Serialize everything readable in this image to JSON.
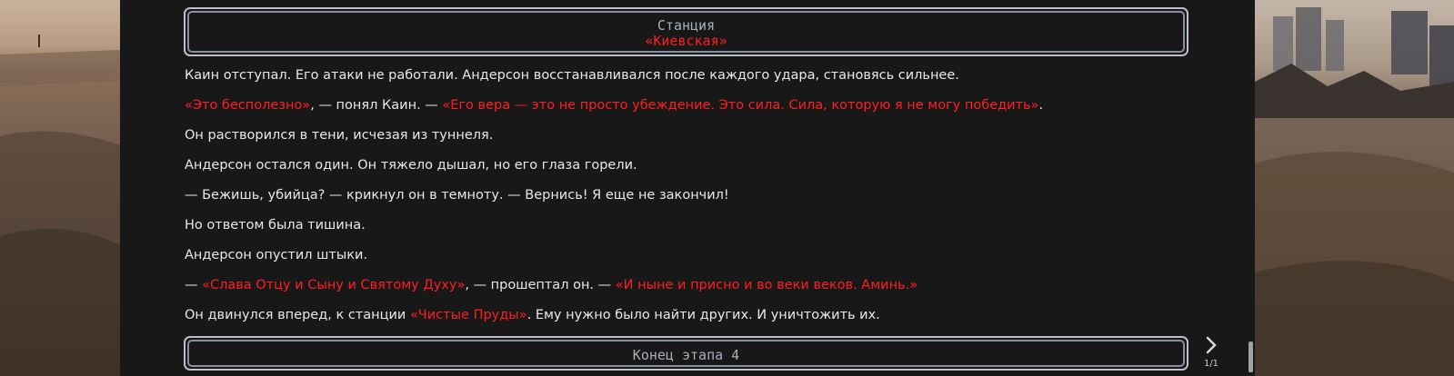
{
  "header": {
    "station_label": "Станция",
    "station_name": "«Киевская»"
  },
  "story": {
    "lines": [
      [
        {
          "text": "Каин отступал. Его атаки не работали. Андерсон восстанавливался после каждого удара, становясь сильнее.",
          "red": false
        }
      ],
      [
        {
          "text": "«Это бесполезно»",
          "red": true
        },
        {
          "text": ", — понял Каин. — ",
          "red": false
        },
        {
          "text": "«Его вера — это не просто убеждение. Это сила. Сила, которую я не могу победить»",
          "red": true
        },
        {
          "text": ".",
          "red": false
        }
      ],
      [
        {
          "text": "Он растворился в тени, исчезая из туннеля.",
          "red": false
        }
      ],
      [
        {
          "text": "Андерсон остался один. Он тяжело дышал, но его глаза горели.",
          "red": false
        }
      ],
      [
        {
          "text": "— Бежишь, убийца? — крикнул он в темноту. — Вернись! Я еще не закончил!",
          "red": false
        }
      ],
      [
        {
          "text": "Но ответом была тишина.",
          "red": false
        }
      ],
      [
        {
          "text": "Андерсон опустил штыки.",
          "red": false
        }
      ],
      [
        {
          "text": "— ",
          "red": false
        },
        {
          "text": "«Слава Отцу и Сыну и Святому Духу»",
          "red": true
        },
        {
          "text": ", — прошептал он. — ",
          "red": false
        },
        {
          "text": "«И ныне и присно и во веки веков. Аминь.»",
          "red": true
        }
      ],
      [
        {
          "text": "Он двинулся вперед, к станции ",
          "red": false
        },
        {
          "text": "«Чистые Пруды»",
          "red": true
        },
        {
          "text": ". Ему нужно было найти других. И уничтожить их.",
          "red": false
        }
      ]
    ]
  },
  "footer": {
    "end_label": "Конец этапа 4",
    "next_icon": "chevron-right-icon",
    "page_counter": "1/1"
  },
  "colors": {
    "accent_red": "#ff1f1f",
    "text": "#e9e9e9",
    "panel_bg": "#181818",
    "frame_border": "#b9c0c9"
  }
}
